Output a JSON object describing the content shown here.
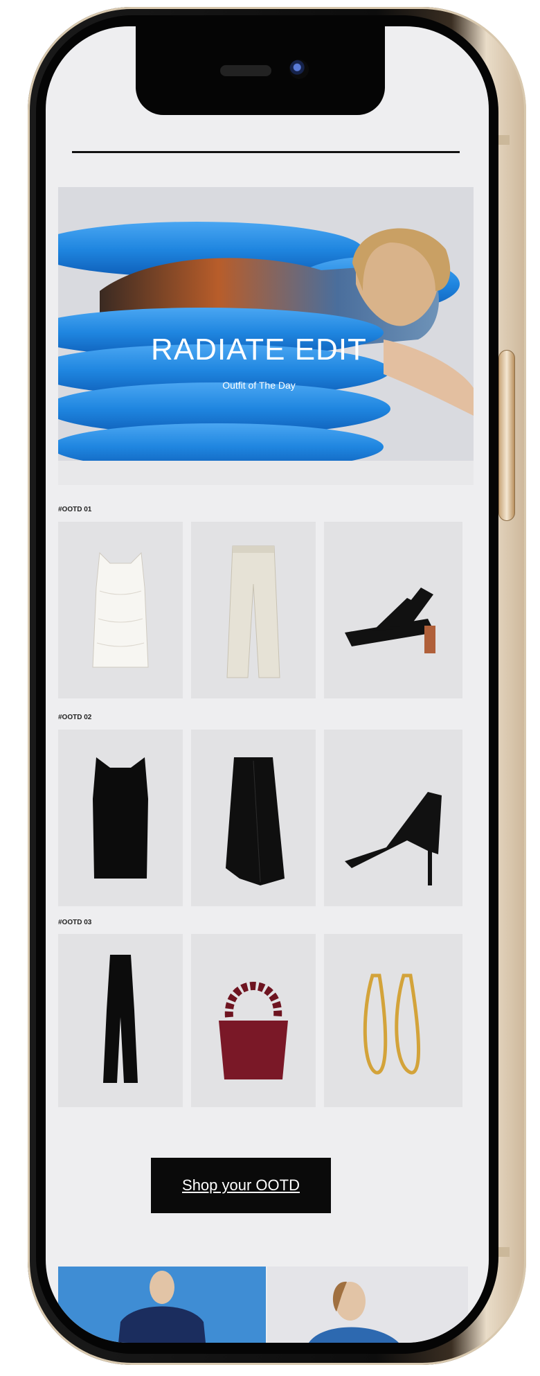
{
  "hero": {
    "title": "RADIATE EDIT",
    "subtitle": "Outfit of The Day"
  },
  "outfits": [
    {
      "label": "#OOTD 01",
      "items": [
        {
          "icon": "lace-vest-top"
        },
        {
          "icon": "cream-trousers"
        },
        {
          "icon": "black-strappy-sandal"
        }
      ]
    },
    {
      "label": "#OOTD 02",
      "items": [
        {
          "icon": "black-draped-top"
        },
        {
          "icon": "black-midi-skirt"
        },
        {
          "icon": "black-heeled-sandal"
        }
      ]
    },
    {
      "label": "#OOTD 03",
      "items": [
        {
          "icon": "black-jumpsuit"
        },
        {
          "icon": "burgundy-ruched-bag"
        },
        {
          "icon": "gold-hoop-earrings"
        }
      ]
    }
  ],
  "cta": {
    "label": "Shop your OOTD"
  },
  "colors": {
    "screen_bg": "#eeeef0",
    "hero_blue": "#1f86e0",
    "cta_bg": "#0a0a0a",
    "frame_gold": "#d8c8ae"
  }
}
